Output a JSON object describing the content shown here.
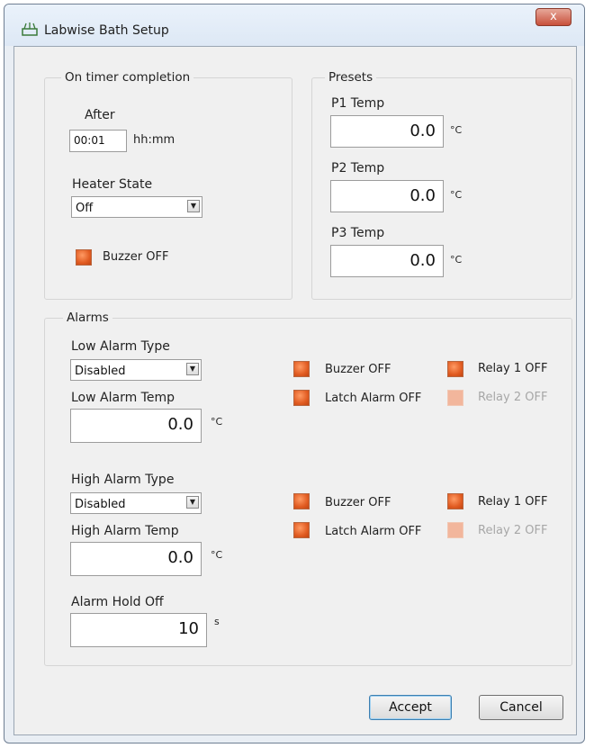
{
  "window": {
    "title": "Labwise Bath Setup",
    "close_label": "x"
  },
  "timer": {
    "legend": "On timer completion",
    "after_label": "After",
    "after_value": "00:01",
    "after_unit": "hh:mm",
    "heater_label": "Heater State",
    "heater_value": "Off",
    "buzzer_label": "Buzzer OFF"
  },
  "presets": {
    "legend": "Presets",
    "items": [
      {
        "label": "P1 Temp",
        "value": "0.0",
        "unit": "°C"
      },
      {
        "label": "P2 Temp",
        "value": "0.0",
        "unit": "°C"
      },
      {
        "label": "P3 Temp",
        "value": "0.0",
        "unit": "°C"
      }
    ]
  },
  "alarms": {
    "legend": "Alarms",
    "low": {
      "type_label": "Low Alarm Type",
      "type_value": "Disabled",
      "temp_label": "Low Alarm Temp",
      "temp_value": "0.0",
      "unit": "°C",
      "buzzer": "Buzzer OFF",
      "latch": "Latch Alarm OFF",
      "relay1": "Relay 1 OFF",
      "relay2": "Relay 2 OFF"
    },
    "high": {
      "type_label": "High Alarm Type",
      "type_value": "Disabled",
      "temp_label": "High Alarm Temp",
      "temp_value": "0.0",
      "unit": "°C",
      "buzzer": "Buzzer OFF",
      "latch": "Latch Alarm OFF",
      "relay1": "Relay 1 OFF",
      "relay2": "Relay 2 OFF"
    },
    "hold_label": "Alarm Hold Off",
    "hold_value": "10",
    "hold_unit": "s"
  },
  "buttons": {
    "accept": "Accept",
    "cancel": "Cancel"
  },
  "colors": {
    "led_on": "#e15c22",
    "led_disabled": "#f2b69c",
    "accent": "#3c7fb1"
  }
}
